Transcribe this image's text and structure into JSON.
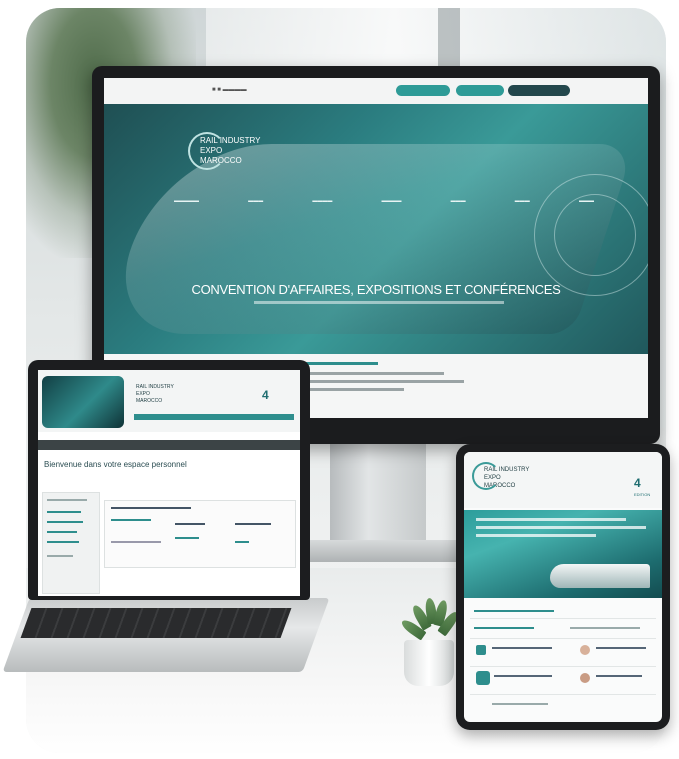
{
  "monitor": {
    "hero_headline": "CONVENTION D'AFFAIRES, EXPOSITIONS ET CONFÉRENCES",
    "logo_text": [
      "RAIL INDUSTRY",
      "EXPO",
      "MAROCCO"
    ],
    "top_buttons": [
      "",
      "",
      ""
    ]
  },
  "laptop": {
    "page_heading": "Bienvenue dans votre espace personnel",
    "logo_text": [
      "RAIL INDUSTRY",
      "EXPO",
      "MAROCCO"
    ],
    "edition": "4"
  },
  "tablet": {
    "logo_text": [
      "RAIL INDUSTRY",
      "EXPO",
      "MAROCCO"
    ],
    "edition": "4",
    "edition_suffix": "EDITION"
  },
  "colors": {
    "accent_teal": "#2e8e8d",
    "dark_teal": "#1e6d70",
    "bezel": "#1c1d1f"
  }
}
